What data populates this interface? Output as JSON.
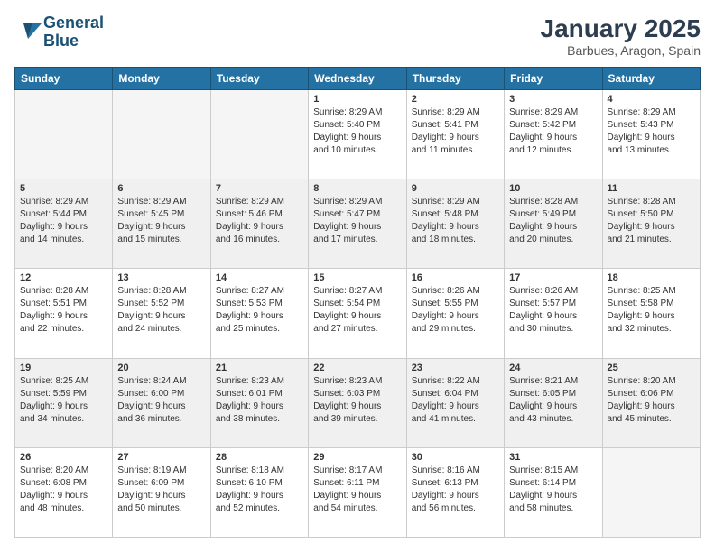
{
  "logo": {
    "line1": "General",
    "line2": "Blue"
  },
  "header": {
    "title": "January 2025",
    "subtitle": "Barbues, Aragon, Spain"
  },
  "days_of_week": [
    "Sunday",
    "Monday",
    "Tuesday",
    "Wednesday",
    "Thursday",
    "Friday",
    "Saturday"
  ],
  "weeks": [
    [
      {
        "num": "",
        "info": "",
        "empty": true
      },
      {
        "num": "",
        "info": "",
        "empty": true
      },
      {
        "num": "",
        "info": "",
        "empty": true
      },
      {
        "num": "1",
        "info": "Sunrise: 8:29 AM\nSunset: 5:40 PM\nDaylight: 9 hours\nand 10 minutes."
      },
      {
        "num": "2",
        "info": "Sunrise: 8:29 AM\nSunset: 5:41 PM\nDaylight: 9 hours\nand 11 minutes."
      },
      {
        "num": "3",
        "info": "Sunrise: 8:29 AM\nSunset: 5:42 PM\nDaylight: 9 hours\nand 12 minutes."
      },
      {
        "num": "4",
        "info": "Sunrise: 8:29 AM\nSunset: 5:43 PM\nDaylight: 9 hours\nand 13 minutes."
      }
    ],
    [
      {
        "num": "5",
        "info": "Sunrise: 8:29 AM\nSunset: 5:44 PM\nDaylight: 9 hours\nand 14 minutes.",
        "shaded": true
      },
      {
        "num": "6",
        "info": "Sunrise: 8:29 AM\nSunset: 5:45 PM\nDaylight: 9 hours\nand 15 minutes.",
        "shaded": true
      },
      {
        "num": "7",
        "info": "Sunrise: 8:29 AM\nSunset: 5:46 PM\nDaylight: 9 hours\nand 16 minutes.",
        "shaded": true
      },
      {
        "num": "8",
        "info": "Sunrise: 8:29 AM\nSunset: 5:47 PM\nDaylight: 9 hours\nand 17 minutes.",
        "shaded": true
      },
      {
        "num": "9",
        "info": "Sunrise: 8:29 AM\nSunset: 5:48 PM\nDaylight: 9 hours\nand 18 minutes.",
        "shaded": true
      },
      {
        "num": "10",
        "info": "Sunrise: 8:28 AM\nSunset: 5:49 PM\nDaylight: 9 hours\nand 20 minutes.",
        "shaded": true
      },
      {
        "num": "11",
        "info": "Sunrise: 8:28 AM\nSunset: 5:50 PM\nDaylight: 9 hours\nand 21 minutes.",
        "shaded": true
      }
    ],
    [
      {
        "num": "12",
        "info": "Sunrise: 8:28 AM\nSunset: 5:51 PM\nDaylight: 9 hours\nand 22 minutes."
      },
      {
        "num": "13",
        "info": "Sunrise: 8:28 AM\nSunset: 5:52 PM\nDaylight: 9 hours\nand 24 minutes."
      },
      {
        "num": "14",
        "info": "Sunrise: 8:27 AM\nSunset: 5:53 PM\nDaylight: 9 hours\nand 25 minutes."
      },
      {
        "num": "15",
        "info": "Sunrise: 8:27 AM\nSunset: 5:54 PM\nDaylight: 9 hours\nand 27 minutes."
      },
      {
        "num": "16",
        "info": "Sunrise: 8:26 AM\nSunset: 5:55 PM\nDaylight: 9 hours\nand 29 minutes."
      },
      {
        "num": "17",
        "info": "Sunrise: 8:26 AM\nSunset: 5:57 PM\nDaylight: 9 hours\nand 30 minutes."
      },
      {
        "num": "18",
        "info": "Sunrise: 8:25 AM\nSunset: 5:58 PM\nDaylight: 9 hours\nand 32 minutes."
      }
    ],
    [
      {
        "num": "19",
        "info": "Sunrise: 8:25 AM\nSunset: 5:59 PM\nDaylight: 9 hours\nand 34 minutes.",
        "shaded": true
      },
      {
        "num": "20",
        "info": "Sunrise: 8:24 AM\nSunset: 6:00 PM\nDaylight: 9 hours\nand 36 minutes.",
        "shaded": true
      },
      {
        "num": "21",
        "info": "Sunrise: 8:23 AM\nSunset: 6:01 PM\nDaylight: 9 hours\nand 38 minutes.",
        "shaded": true
      },
      {
        "num": "22",
        "info": "Sunrise: 8:23 AM\nSunset: 6:03 PM\nDaylight: 9 hours\nand 39 minutes.",
        "shaded": true
      },
      {
        "num": "23",
        "info": "Sunrise: 8:22 AM\nSunset: 6:04 PM\nDaylight: 9 hours\nand 41 minutes.",
        "shaded": true
      },
      {
        "num": "24",
        "info": "Sunrise: 8:21 AM\nSunset: 6:05 PM\nDaylight: 9 hours\nand 43 minutes.",
        "shaded": true
      },
      {
        "num": "25",
        "info": "Sunrise: 8:20 AM\nSunset: 6:06 PM\nDaylight: 9 hours\nand 45 minutes.",
        "shaded": true
      }
    ],
    [
      {
        "num": "26",
        "info": "Sunrise: 8:20 AM\nSunset: 6:08 PM\nDaylight: 9 hours\nand 48 minutes."
      },
      {
        "num": "27",
        "info": "Sunrise: 8:19 AM\nSunset: 6:09 PM\nDaylight: 9 hours\nand 50 minutes."
      },
      {
        "num": "28",
        "info": "Sunrise: 8:18 AM\nSunset: 6:10 PM\nDaylight: 9 hours\nand 52 minutes."
      },
      {
        "num": "29",
        "info": "Sunrise: 8:17 AM\nSunset: 6:11 PM\nDaylight: 9 hours\nand 54 minutes."
      },
      {
        "num": "30",
        "info": "Sunrise: 8:16 AM\nSunset: 6:13 PM\nDaylight: 9 hours\nand 56 minutes."
      },
      {
        "num": "31",
        "info": "Sunrise: 8:15 AM\nSunset: 6:14 PM\nDaylight: 9 hours\nand 58 minutes."
      },
      {
        "num": "",
        "info": "",
        "empty": true
      }
    ]
  ]
}
